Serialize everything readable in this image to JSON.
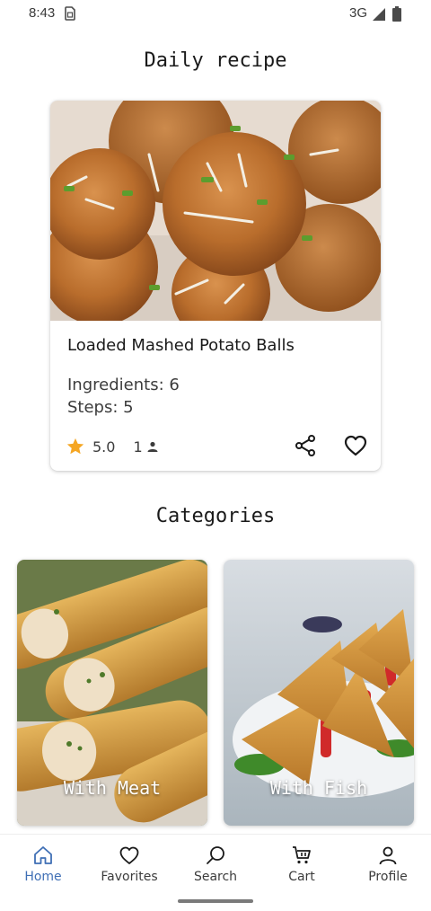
{
  "status_bar": {
    "time": "8:43",
    "network": "3G",
    "icons": [
      "sim-card-icon",
      "signal-icon",
      "battery-icon"
    ]
  },
  "daily": {
    "section_title": "Daily recipe",
    "recipe": {
      "name": "Loaded Mashed Potato Balls",
      "ingredients": "Ingredients: 6",
      "steps": "Steps: 5",
      "rating": "5.0",
      "servings": "1",
      "icons": [
        "star-icon",
        "person-icon",
        "share-icon",
        "heart-icon"
      ]
    }
  },
  "categories": {
    "section_title": "Categories",
    "items": [
      {
        "label": "With Meat"
      },
      {
        "label": "With Fish"
      }
    ]
  },
  "bottom_nav": {
    "items": [
      {
        "label": "Home",
        "icon": "home-icon",
        "active": true
      },
      {
        "label": "Favorites",
        "icon": "heart-icon",
        "active": false
      },
      {
        "label": "Search",
        "icon": "search-icon",
        "active": false
      },
      {
        "label": "Cart",
        "icon": "cart-icon",
        "active": false
      },
      {
        "label": "Profile",
        "icon": "profile-icon",
        "active": false
      }
    ]
  },
  "colors": {
    "accent": "#3f6fb5",
    "star": "#f5a623",
    "text": "#1a1a1a"
  }
}
